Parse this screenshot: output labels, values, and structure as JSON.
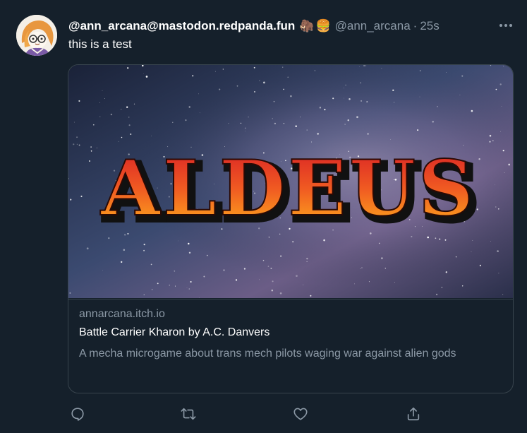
{
  "tweet": {
    "display_name": "@ann_arcana@mastodon.redpanda.fun",
    "name_emoji": [
      "🦣",
      "🍔"
    ],
    "handle": "@ann_arcana",
    "separator": "·",
    "time": "25s",
    "text": "this is a test"
  },
  "card": {
    "image_logo_text": "ALDEUS",
    "domain": "annarcana.itch.io",
    "title": "Battle Carrier Kharon by A.C. Danvers",
    "description": "A mecha microgame about trans mech pilots waging war against alien gods"
  },
  "icons": {
    "reply": "reply-icon",
    "retweet": "retweet-icon",
    "like": "heart-icon",
    "share": "share-icon",
    "more": "more-icon"
  },
  "colors": {
    "background": "#15202b",
    "border": "#38444d",
    "secondary_text": "#8b98a5",
    "primary_text": "#ffffff"
  }
}
